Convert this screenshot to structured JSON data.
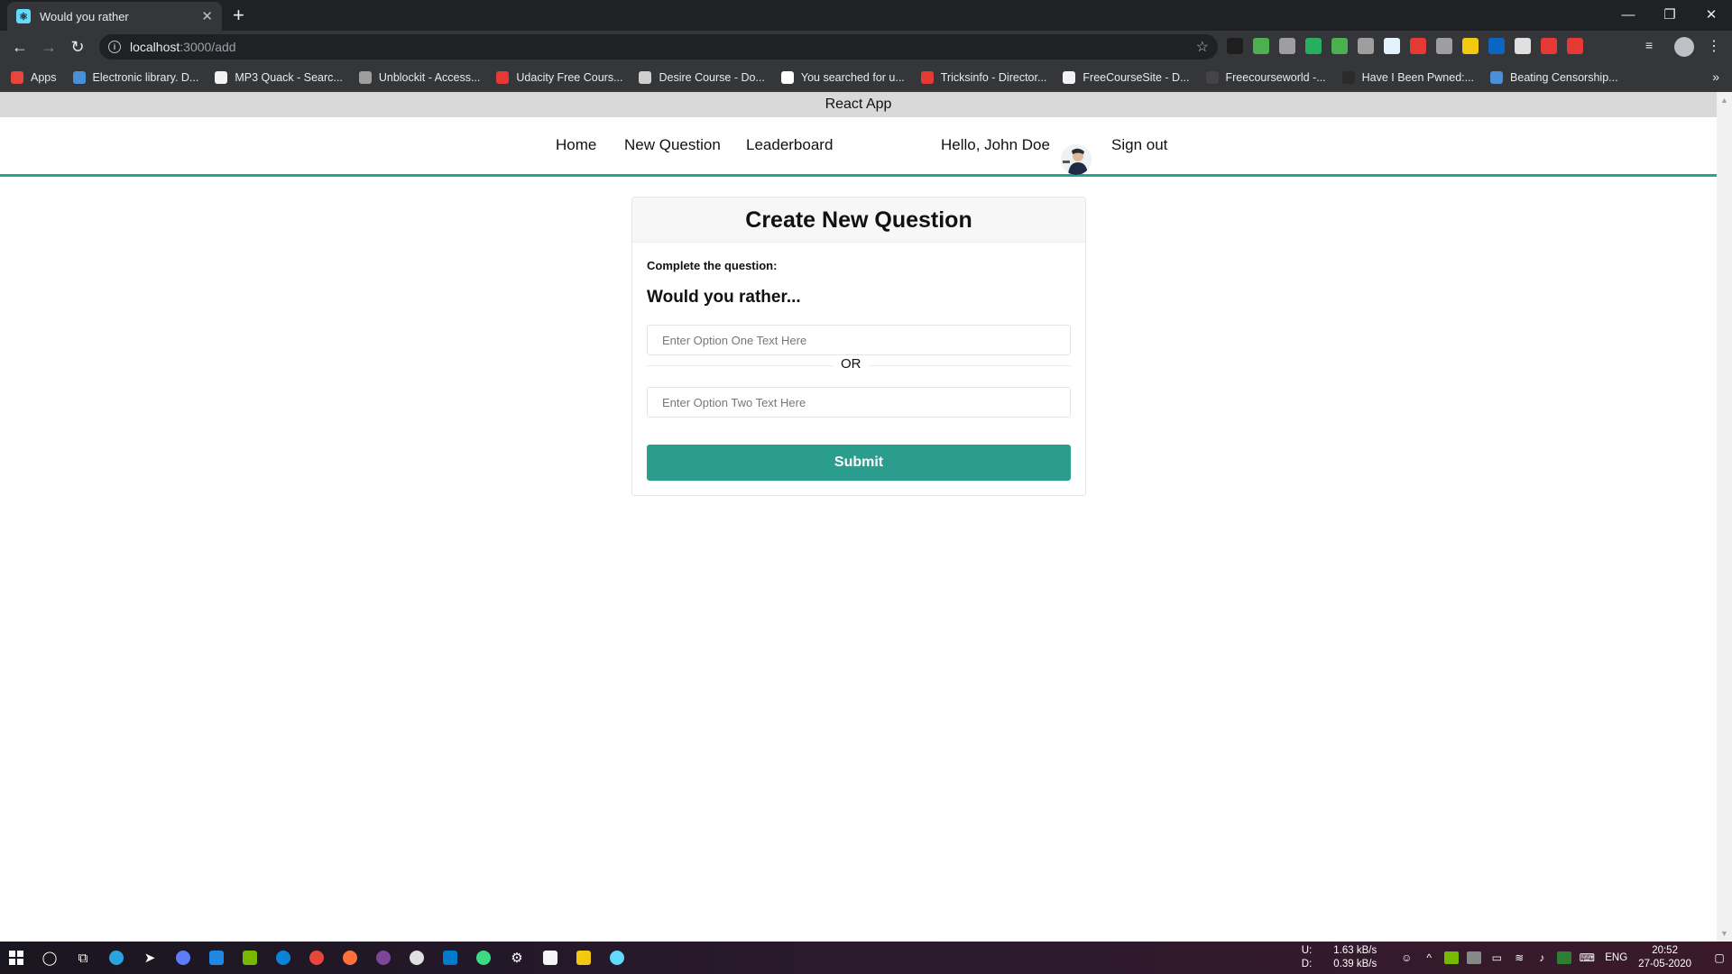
{
  "browser": {
    "tab_title": "Would you rather",
    "tab_close": "✕",
    "new_tab": "+",
    "window_controls": [
      "—",
      "❐",
      "✕"
    ],
    "url_host": "localhost",
    "url_path": ":3000/add",
    "bookmarks": [
      {
        "label": "Apps",
        "color": "#e8453c"
      },
      {
        "label": "Electronic library. D...",
        "color": "#4a90d9"
      },
      {
        "label": "MP3 Quack - Searc...",
        "color": "#f2f2f2"
      },
      {
        "label": "Unblockit - Access...",
        "color": "#9e9e9e"
      },
      {
        "label": "Udacity Free Cours...",
        "color": "#e53935"
      },
      {
        "label": "Desire Course - Do...",
        "color": "#cfcfcf"
      },
      {
        "label": "You searched for u...",
        "color": "#ffffff"
      },
      {
        "label": "Tricksinfo - Director...",
        "color": "#e53935"
      },
      {
        "label": "FreeCourseSite - D...",
        "color": "#f2f2f2"
      },
      {
        "label": "Freecourseworld -...",
        "color": "#444444"
      },
      {
        "label": "Have I Been Pwned:...",
        "color": "#2a2a2a"
      },
      {
        "label": "Beating Censorship...",
        "color": "#4a90d9"
      }
    ],
    "extension_colors": [
      "#1e1e1e",
      "#4caf50",
      "#9e9e9e",
      "#27ae60",
      "#4caf50",
      "#9e9e9e",
      "#e3f2fd",
      "#e53935",
      "#9e9e9e",
      "#f2c811",
      "#0a66c2",
      "#e0e0e0",
      "#e53935",
      "#e53935"
    ]
  },
  "app": {
    "title": "React App",
    "nav": {
      "home": "Home",
      "new_question": "New Question",
      "leaderboard": "Leaderboard",
      "greeting": "Hello, John Doe",
      "sign_out": "Sign out"
    },
    "card": {
      "title": "Create New Question",
      "prompt": "Complete the question:",
      "would_you_rather": "Would you rather...",
      "option_one_placeholder": "Enter Option One Text Here",
      "or_label": "OR",
      "option_two_placeholder": "Enter Option Two Text Here",
      "submit_label": "Submit"
    },
    "accent_color": "#2a9d8f"
  },
  "taskbar": {
    "net_upload_label": "U:",
    "net_upload": "1.63 kB/s",
    "net_download_label": "D:",
    "net_download": "0.39 kB/s",
    "language": "ENG",
    "time": "20:52",
    "date": "27-05-2020"
  }
}
